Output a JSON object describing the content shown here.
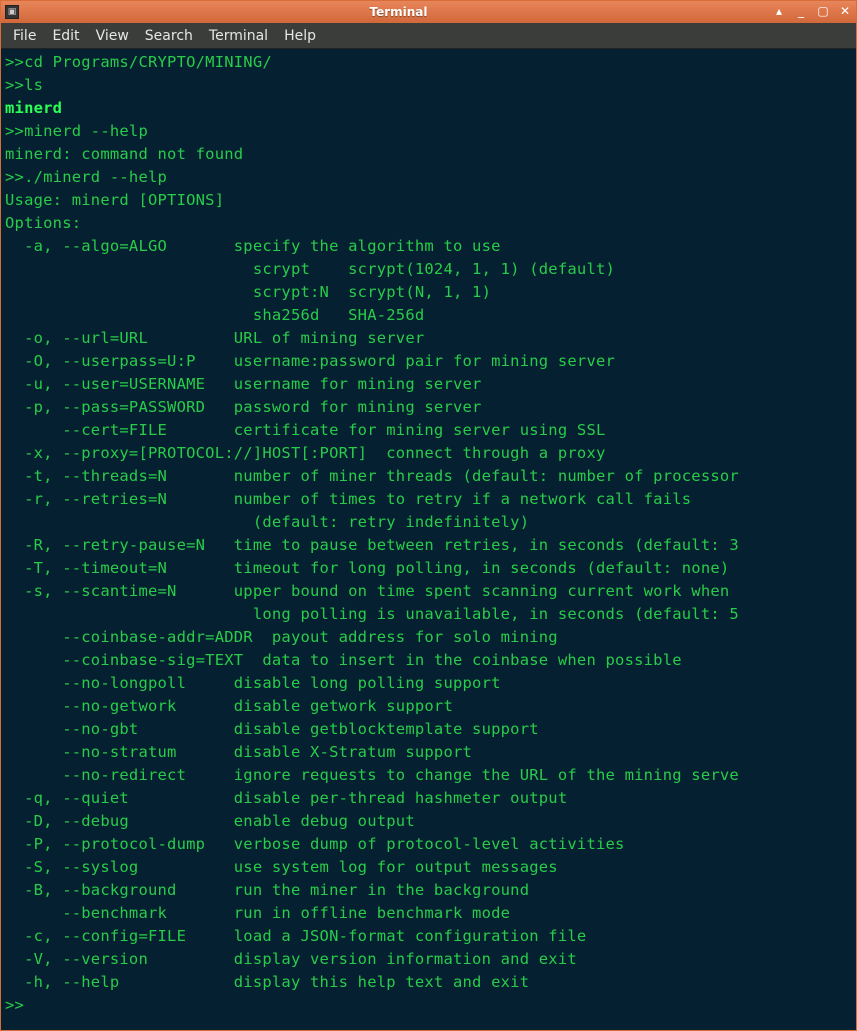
{
  "window": {
    "title": "Terminal"
  },
  "menu": {
    "file": "File",
    "edit": "Edit",
    "view": "View",
    "search": "Search",
    "terminal": "Terminal",
    "help": "Help"
  },
  "lines": {
    "l01": ">>cd Programs/CRYPTO/MINING/",
    "l02": ">>ls",
    "l03": "minerd",
    "l04": ">>minerd --help",
    "l05": "minerd: command not found",
    "l06": ">>./minerd --help",
    "l07": "Usage: minerd [OPTIONS]",
    "l08": "Options:",
    "l09": "  -a, --algo=ALGO       specify the algorithm to use",
    "l10": "                          scrypt    scrypt(1024, 1, 1) (default)",
    "l11": "                          scrypt:N  scrypt(N, 1, 1)",
    "l12": "                          sha256d   SHA-256d",
    "l13": "  -o, --url=URL         URL of mining server",
    "l14": "  -O, --userpass=U:P    username:password pair for mining server",
    "l15": "  -u, --user=USERNAME   username for mining server",
    "l16": "  -p, --pass=PASSWORD   password for mining server",
    "l17": "      --cert=FILE       certificate for mining server using SSL",
    "l18": "  -x, --proxy=[PROTOCOL://]HOST[:PORT]  connect through a proxy",
    "l19": "  -t, --threads=N       number of miner threads (default: number of processor",
    "l20": "  -r, --retries=N       number of times to retry if a network call fails",
    "l21": "                          (default: retry indefinitely)",
    "l22": "  -R, --retry-pause=N   time to pause between retries, in seconds (default: 3",
    "l23": "  -T, --timeout=N       timeout for long polling, in seconds (default: none)",
    "l24": "  -s, --scantime=N      upper bound on time spent scanning current work when",
    "l25": "                          long polling is unavailable, in seconds (default: 5",
    "l26": "      --coinbase-addr=ADDR  payout address for solo mining",
    "l27": "      --coinbase-sig=TEXT  data to insert in the coinbase when possible",
    "l28": "      --no-longpoll     disable long polling support",
    "l29": "      --no-getwork      disable getwork support",
    "l30": "      --no-gbt          disable getblocktemplate support",
    "l31": "      --no-stratum      disable X-Stratum support",
    "l32": "      --no-redirect     ignore requests to change the URL of the mining serve",
    "l33": "  -q, --quiet           disable per-thread hashmeter output",
    "l34": "  -D, --debug           enable debug output",
    "l35": "  -P, --protocol-dump   verbose dump of protocol-level activities",
    "l36": "  -S, --syslog          use system log for output messages",
    "l37": "  -B, --background      run the miner in the background",
    "l38": "      --benchmark       run in offline benchmark mode",
    "l39": "  -c, --config=FILE     load a JSON-format configuration file",
    "l40": "  -V, --version         display version information and exit",
    "l41": "  -h, --help            display this help text and exit",
    "l42": ">>"
  }
}
